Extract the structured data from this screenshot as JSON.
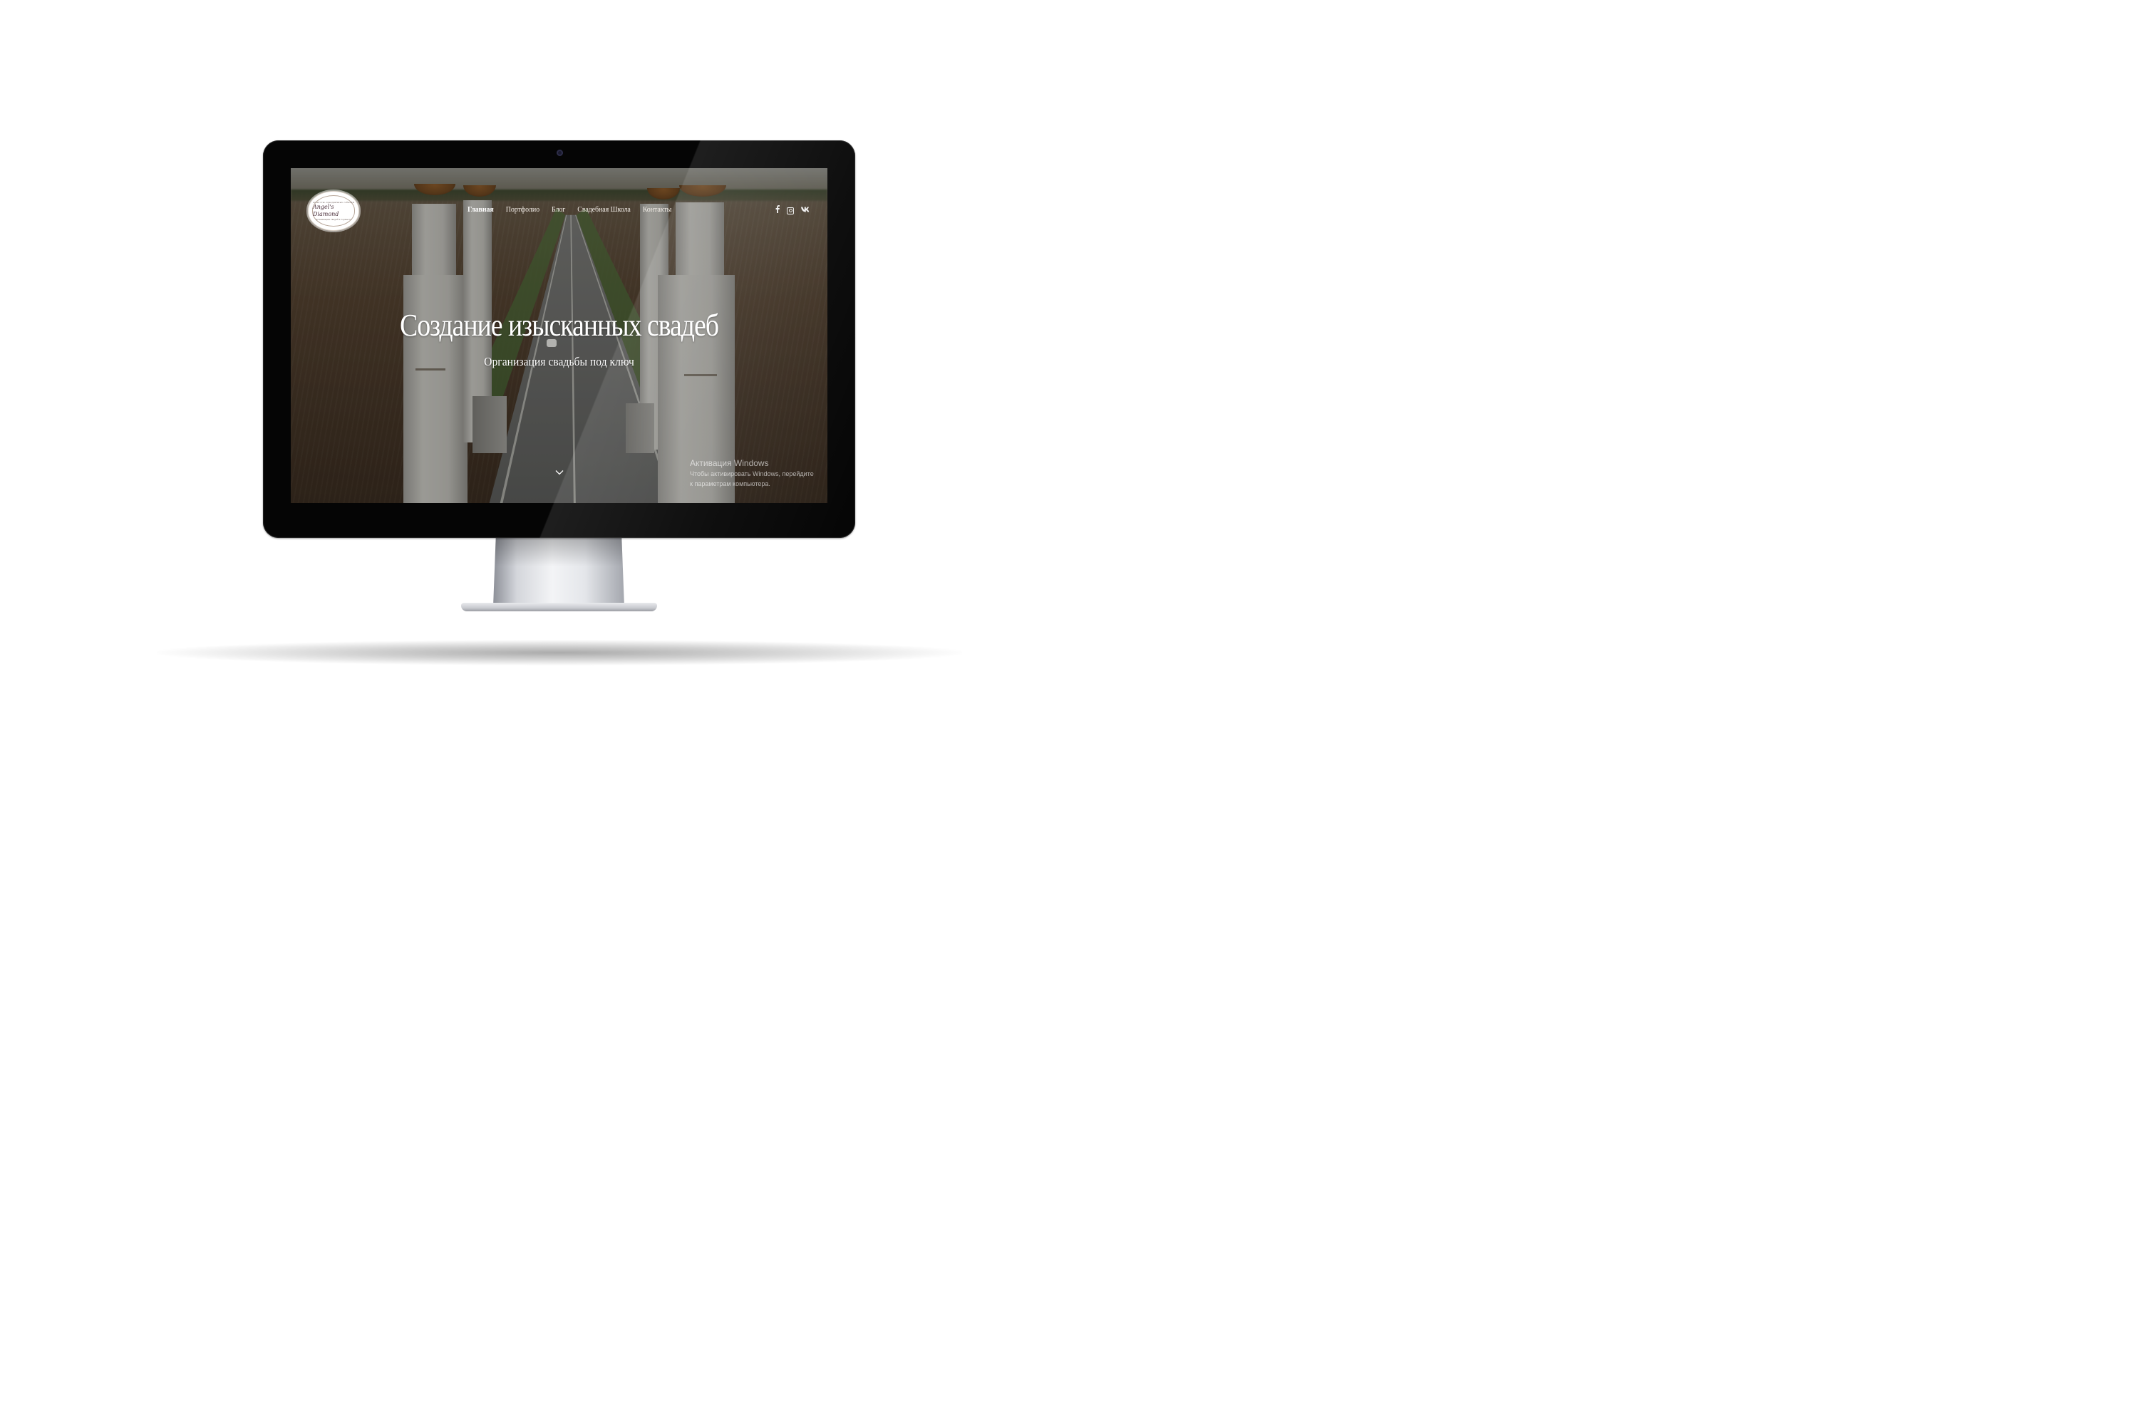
{
  "site": {
    "logo": {
      "top_text": "агентство праздничных событий",
      "name": "Angel's Diamond",
      "bottom_text": "организация свадеб и торжеств"
    },
    "nav": {
      "items": [
        "Главная",
        "Портфолио",
        "Блог",
        "Свадебная Школа",
        "Контакты"
      ],
      "active_index": 0
    },
    "social_icons": [
      "facebook-icon",
      "instagram-icon",
      "vk-icon"
    ],
    "hero": {
      "title": "Создание изысканных свадеб",
      "subtitle": "Организация свадьбы под ключ"
    }
  },
  "os_overlay": {
    "title": "Активация Windows",
    "text": "Чтобы активировать Windows, перейдите к параметрам компьютера."
  },
  "colors": {
    "bezel": "#050505",
    "hero_text": "#ffffff",
    "logo_accent": "#4a2e3a"
  }
}
